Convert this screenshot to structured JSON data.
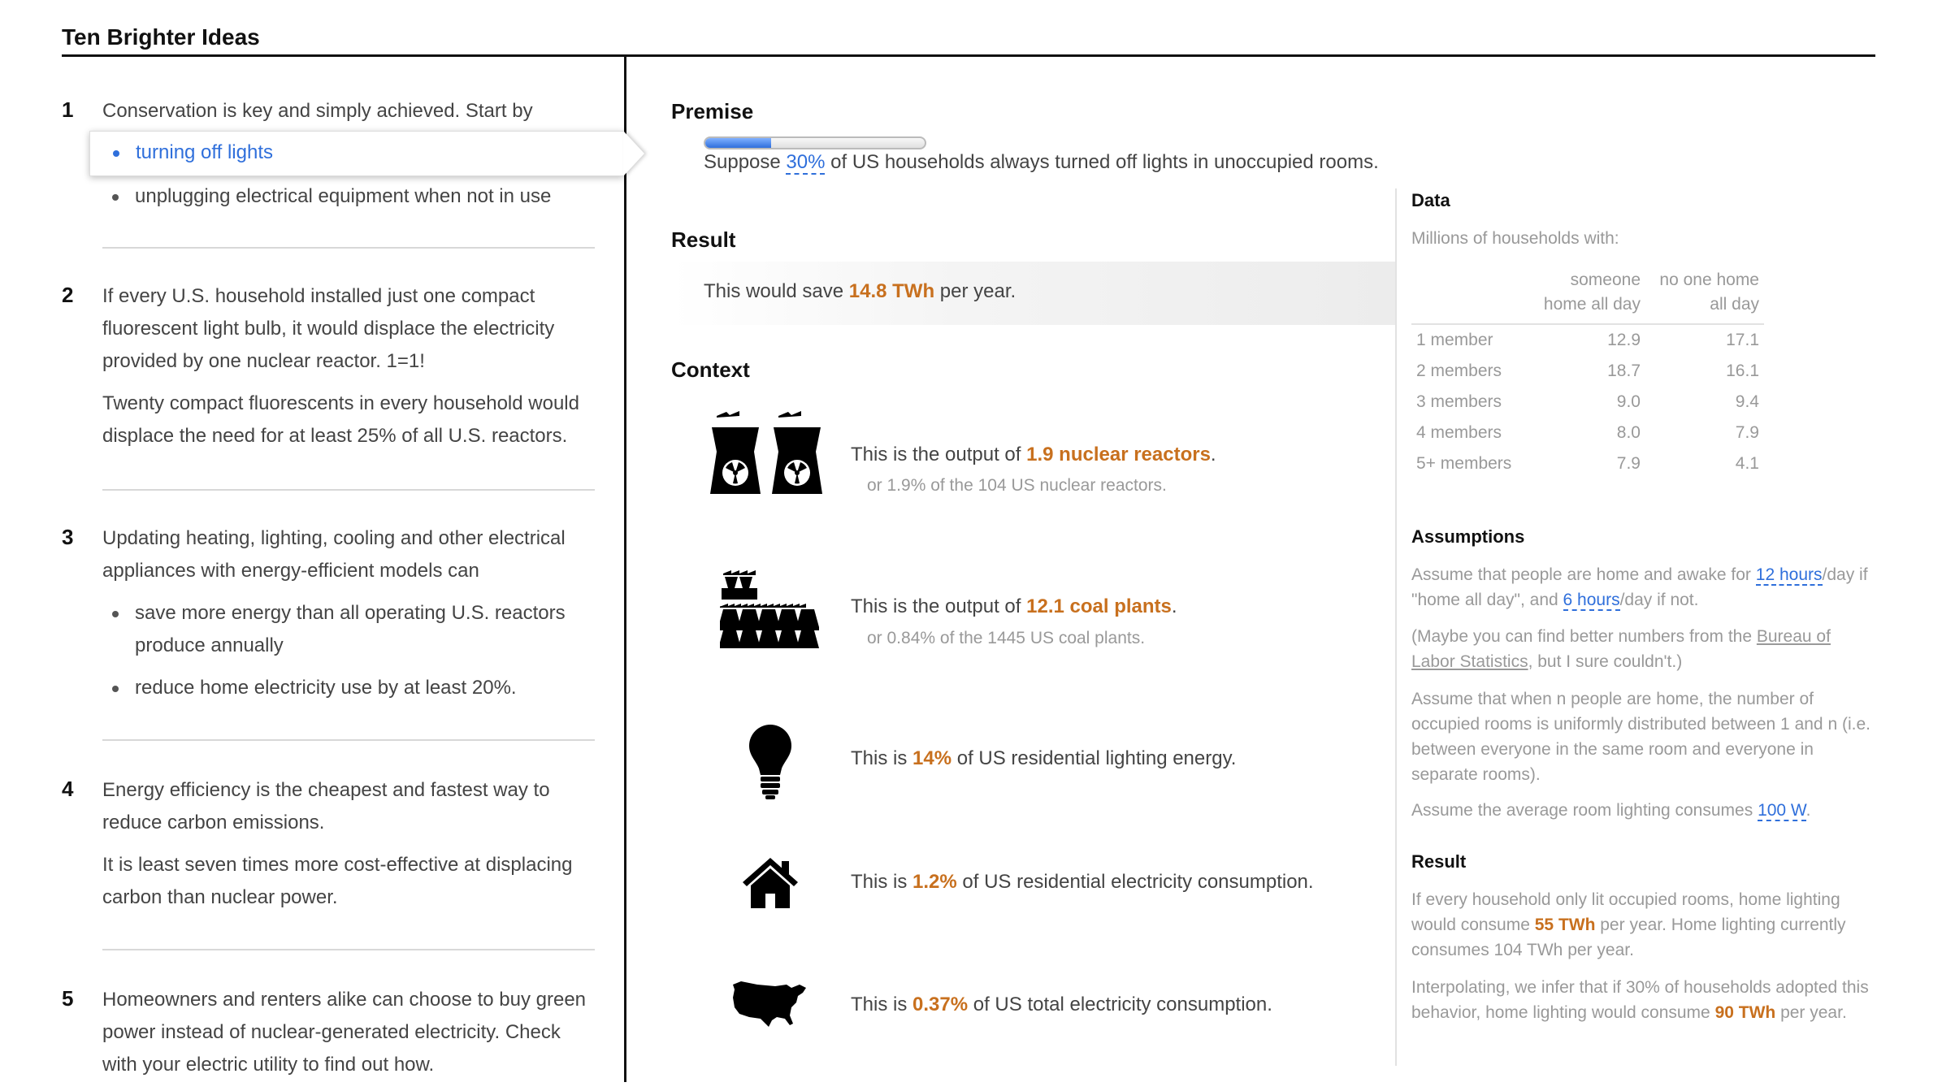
{
  "title": "Ten Brighter Ideas",
  "ideas": [
    {
      "num": "1",
      "intro": "Conservation is key and simply achieved. Start by",
      "selected": "turning off lights",
      "items": [
        "unplugging electrical equipment when not in use"
      ]
    },
    {
      "num": "2",
      "p1": "If every U.S. household installed just one compact fluorescent light bulb, it would displace the electricity provided by one nuclear reactor. 1=1!",
      "p2": "Twenty compact fluorescents in every household would displace the need for at least 25% of all U.S. reactors."
    },
    {
      "num": "3",
      "intro": "Updating heating, lighting, cooling and other electrical appliances with energy-efficient models can",
      "items": [
        "save more energy than all operating U.S. reactors produce annually",
        "reduce home electricity use by at least 20%."
      ]
    },
    {
      "num": "4",
      "p1": "Energy efficiency is the cheapest and fastest way to reduce carbon emissions.",
      "p2": "It is least seven times more cost-effective at displacing carbon than nuclear power."
    },
    {
      "num": "5",
      "p1": "Homeowners and renters alike can choose to buy green power instead of nuclear-generated electricity. Check with your electric utility to find out how."
    }
  ],
  "premise": {
    "heading": "Premise",
    "progress_fraction": 0.3,
    "text_before": "Suppose ",
    "value": "30%",
    "text_after": " of US households always turned off lights in unoccupied rooms."
  },
  "result": {
    "heading": "Result",
    "text_before": "This would save ",
    "value": "14.8 TWh",
    "text_after": " per year."
  },
  "context": {
    "heading": "Context",
    "items": [
      {
        "icon": "nuclear-reactor-icon",
        "before": "This is the output of ",
        "value": "1.9 nuclear reactors",
        "after": ".",
        "sub": "or 1.9% of the 104 US nuclear reactors."
      },
      {
        "icon": "coal-plant-icon",
        "before": "This is the output of ",
        "value": "12.1 coal plants",
        "after": ".",
        "sub": "or 0.84% of the 1445 US coal plants."
      },
      {
        "icon": "light-bulb-icon",
        "before": "This is ",
        "value": "14%",
        "after": " of US residential lighting energy.",
        "sub": ""
      },
      {
        "icon": "house-icon",
        "before": "This is ",
        "value": "1.2%",
        "after": " of US residential electricity consumption.",
        "sub": ""
      },
      {
        "icon": "usa-map-icon",
        "before": "This is ",
        "value": "0.37%",
        "after": " of US total electricity consumption.",
        "sub": ""
      }
    ]
  },
  "data": {
    "heading": "Data",
    "caption": "Millions of households with:",
    "col1": "someone home all day",
    "col2": "no one home all day",
    "rows": [
      {
        "label": "1 member",
        "a": "12.9",
        "b": "17.1"
      },
      {
        "label": "2 members",
        "a": "18.7",
        "b": "16.1"
      },
      {
        "label": "3 members",
        "a": "9.0",
        "b": "9.4"
      },
      {
        "label": "4 members",
        "a": "8.0",
        "b": "7.9"
      },
      {
        "label": "5+ members",
        "a": "7.9",
        "b": "4.1"
      }
    ]
  },
  "assumptions": {
    "heading": "Assumptions",
    "p1_a": "Assume that people are home and awake for ",
    "p1_link1": "12 hours",
    "p1_b": "/day if \"home all day\", and ",
    "p1_link2": "6 hours",
    "p1_c": "/day if not.",
    "p2_a": "(Maybe you can find better numbers from the ",
    "p2_link": "Bureau of Labor Statistics",
    "p2_b": ", but I sure couldn't.)",
    "p3": "Assume that when n people are home, the number of occupied rooms is uniformly distributed between 1 and n (i.e. between everyone in the same room and everyone in separate rooms).",
    "p4_a": "Assume the average room lighting consumes ",
    "p4_link": "100 W",
    "p4_b": "."
  },
  "right_result": {
    "heading": "Result",
    "p1_a": "If every household only lit occupied rooms, home lighting would consume ",
    "p1_value": "55 TWh",
    "p1_b": " per year. Home lighting currently consumes 104 TWh per year.",
    "p2_a": "Interpolating, we infer that if 30% of households adopted this behavior, home lighting would consume ",
    "p2_value": "90 TWh",
    "p2_b": " per year."
  }
}
